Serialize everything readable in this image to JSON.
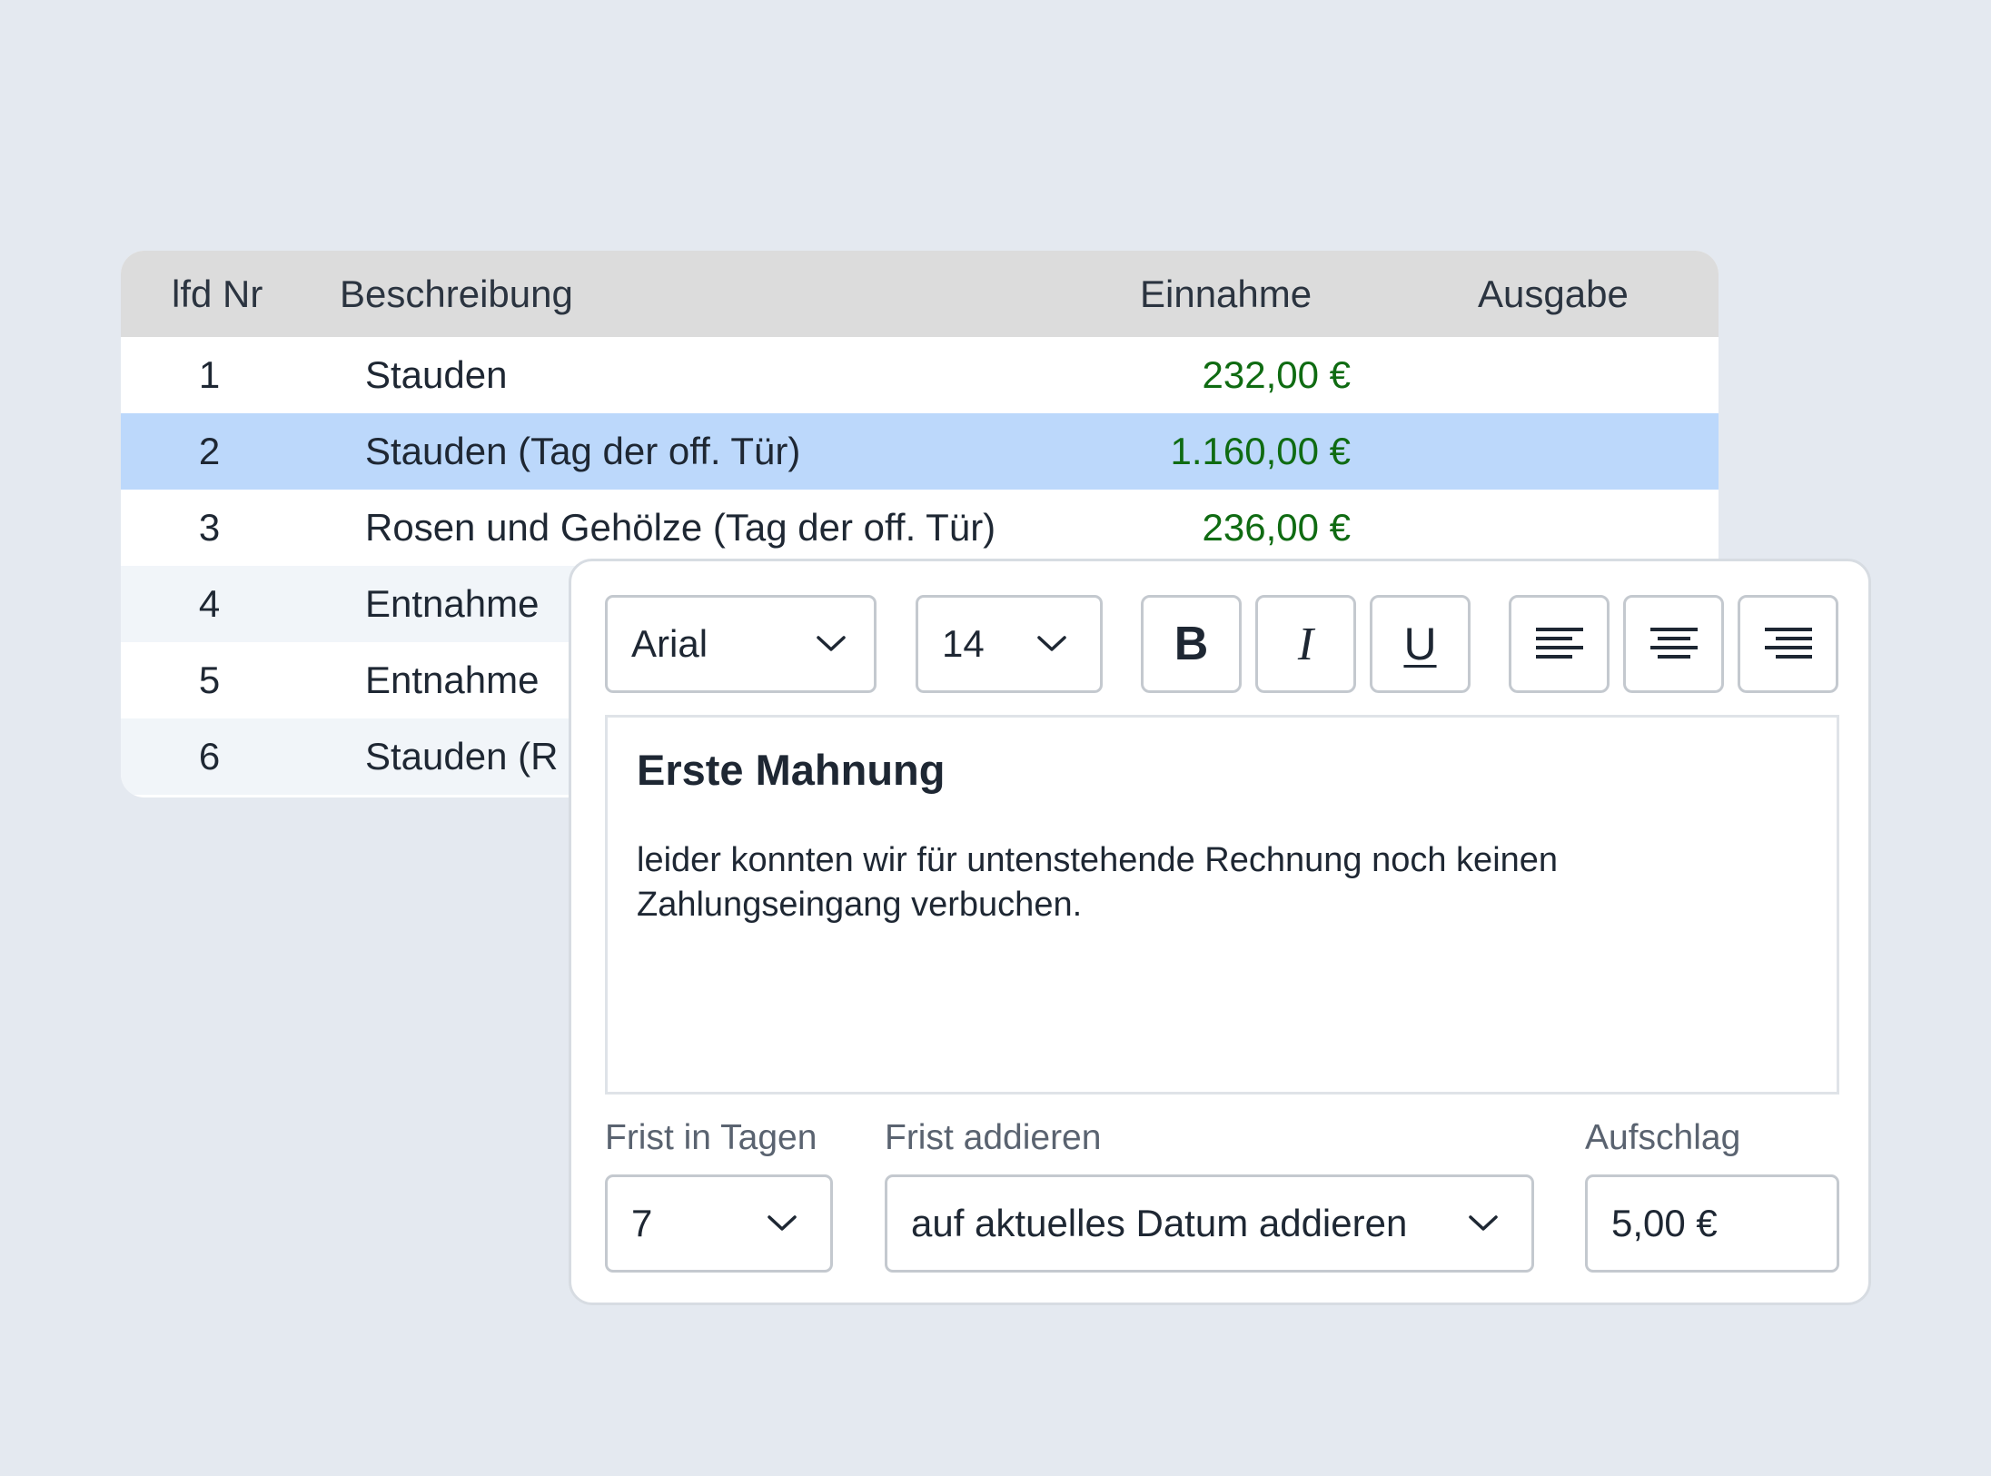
{
  "table": {
    "headers": {
      "nr": "lfd Nr",
      "description": "Beschreibung",
      "income": "Einnahme",
      "expense": "Ausgabe"
    },
    "rows": [
      {
        "nr": "1",
        "description": "Stauden",
        "income": "232,00 €",
        "expense": ""
      },
      {
        "nr": "2",
        "description": "Stauden (Tag der off. Tür)",
        "income": "1.160,00 €",
        "expense": "",
        "selected": true
      },
      {
        "nr": "3",
        "description": "Rosen und Gehölze (Tag der off. Tür)",
        "income": "236,00 €",
        "expense": ""
      },
      {
        "nr": "4",
        "description": "Entnahme",
        "income": "",
        "expense": ""
      },
      {
        "nr": "5",
        "description": "Entnahme",
        "income": "",
        "expense": ""
      },
      {
        "nr": "6",
        "description": "Stauden (R",
        "income": "",
        "expense": ""
      }
    ]
  },
  "toolbar": {
    "font_family": "Arial",
    "font_size": "14",
    "bold_label": "B",
    "italic_label": "I",
    "underline_label": "U",
    "buttons": [
      "bold-icon",
      "italic-icon",
      "underline-icon",
      "align-left-icon",
      "align-center-icon",
      "align-right-icon"
    ]
  },
  "editor": {
    "heading": "Erste Mahnung",
    "body": "leider konnten wir für untenstehende Rechnung noch keinen Zahlungseingang verbuchen."
  },
  "fields": {
    "deadline_label": "Frist in Tagen",
    "deadline_value": "7",
    "add_label": "Frist addieren",
    "add_value": "auf aktuelles Datum addieren",
    "surcharge_label": "Aufschlag",
    "surcharge_value": "5,00 €"
  },
  "colors": {
    "background": "#e4e9f0",
    "table_header": "#dcdcdc",
    "row_selected": "#bcd8fb",
    "row_alt": "#f1f5f9",
    "income_text": "#0f6b12",
    "border": "#c4c9cf"
  }
}
